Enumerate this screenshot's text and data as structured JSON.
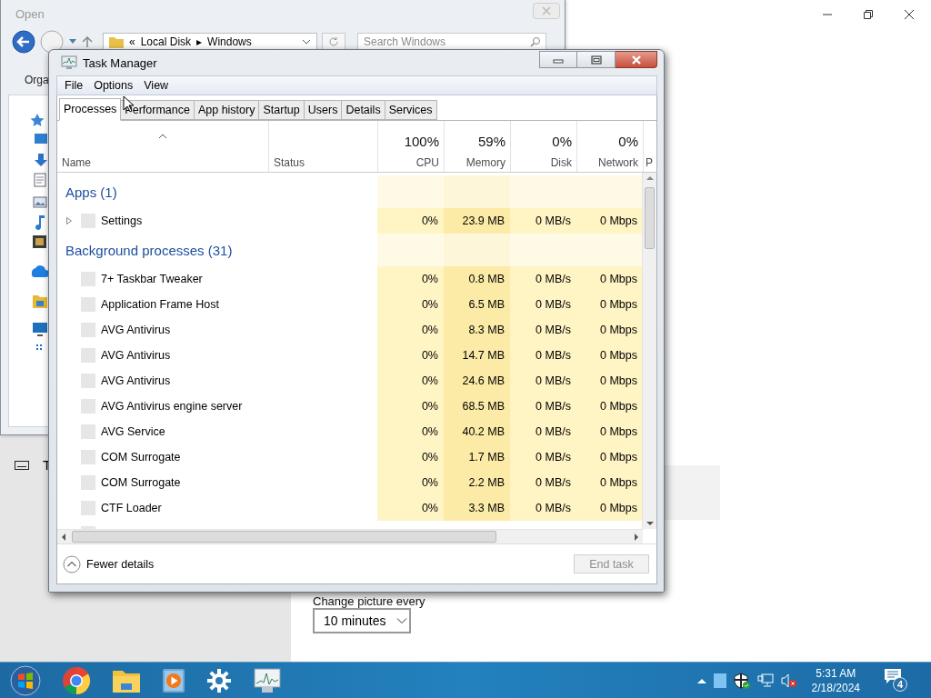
{
  "settings_window": {
    "section_letter": "T",
    "picture_interval_label": "Change picture every",
    "picture_interval": {
      "value": "10 minutes"
    }
  },
  "open_dialog": {
    "title": "Open",
    "address": {
      "overflow_mark": "«",
      "items": [
        "Local Disk",
        "Windows"
      ],
      "separator": "▸"
    },
    "search": {
      "placeholder": "Search Windows"
    },
    "toolbar": {
      "label": "Orga"
    }
  },
  "task_manager": {
    "title": "Task Manager",
    "menu": [
      "File",
      "Options",
      "View"
    ],
    "tabs": [
      {
        "label": "Processes",
        "selected": true
      },
      {
        "label": "Performance",
        "selected": false
      },
      {
        "label": "App history",
        "selected": false
      },
      {
        "label": "Startup",
        "selected": false
      },
      {
        "label": "Users",
        "selected": false
      },
      {
        "label": "Details",
        "selected": false
      },
      {
        "label": "Services",
        "selected": false
      }
    ],
    "columns": [
      {
        "label": "Name",
        "sorted": true
      },
      {
        "label": "Status",
        "sorted": false
      },
      {
        "label": "CPU",
        "total": "100%",
        "sorted": false,
        "color": "#fff4c4"
      },
      {
        "label": "Memory",
        "total": "59%",
        "sorted": false,
        "color": "#fbeba6"
      },
      {
        "label": "Disk",
        "total": "0%",
        "sorted": false,
        "color": "#fff4c4"
      },
      {
        "label": "Network",
        "total": "0%",
        "sorted": false,
        "color": "#fff4c4"
      },
      {
        "label": "P",
        "sorted": false
      }
    ],
    "groups": [
      {
        "title": "Apps (1)",
        "rows": [
          {
            "kind": "app",
            "expanded": false,
            "name": "Settings",
            "cpu": "0%",
            "memory": "23.9 MB",
            "disk": "0 MB/s",
            "network": "0 Mbps"
          }
        ]
      },
      {
        "title": "Background processes (31)",
        "rows": [
          {
            "kind": "process",
            "name": "7+ Taskbar Tweaker",
            "cpu": "0%",
            "memory": "0.8 MB",
            "disk": "0 MB/s",
            "network": "0 Mbps"
          },
          {
            "kind": "process",
            "name": "Application Frame Host",
            "cpu": "0%",
            "memory": "6.5 MB",
            "disk": "0 MB/s",
            "network": "0 Mbps"
          },
          {
            "kind": "process",
            "name": "AVG Antivirus",
            "cpu": "0%",
            "memory": "8.3 MB",
            "disk": "0 MB/s",
            "network": "0 Mbps"
          },
          {
            "kind": "process",
            "name": "AVG Antivirus",
            "cpu": "0%",
            "memory": "14.7 MB",
            "disk": "0 MB/s",
            "network": "0 Mbps"
          },
          {
            "kind": "process",
            "name": "AVG Antivirus",
            "cpu": "0%",
            "memory": "24.6 MB",
            "disk": "0 MB/s",
            "network": "0 Mbps"
          },
          {
            "kind": "process",
            "name": "AVG Antivirus engine server",
            "cpu": "0%",
            "memory": "68.5 MB",
            "disk": "0 MB/s",
            "network": "0 Mbps"
          },
          {
            "kind": "process",
            "name": "AVG Service",
            "cpu": "0%",
            "memory": "40.2 MB",
            "disk": "0 MB/s",
            "network": "0 Mbps"
          },
          {
            "kind": "process",
            "name": "COM Surrogate",
            "cpu": "0%",
            "memory": "1.7 MB",
            "disk": "0 MB/s",
            "network": "0 Mbps"
          },
          {
            "kind": "process",
            "name": "COM Surrogate",
            "cpu": "0%",
            "memory": "2.2 MB",
            "disk": "0 MB/s",
            "network": "0 Mbps"
          },
          {
            "kind": "process",
            "name": "CTF Loader",
            "cpu": "0%",
            "memory": "3.3 MB",
            "disk": "0 MB/s",
            "network": "0 Mbps"
          }
        ]
      }
    ],
    "details_toggle": {
      "label": "Fewer details"
    },
    "end_task": {
      "label": "End task",
      "disabled": true
    }
  },
  "taskbar": {
    "clock": {
      "time": "5:31 AM",
      "date": "2/18/2024"
    },
    "notifications": {
      "count": "4"
    }
  }
}
